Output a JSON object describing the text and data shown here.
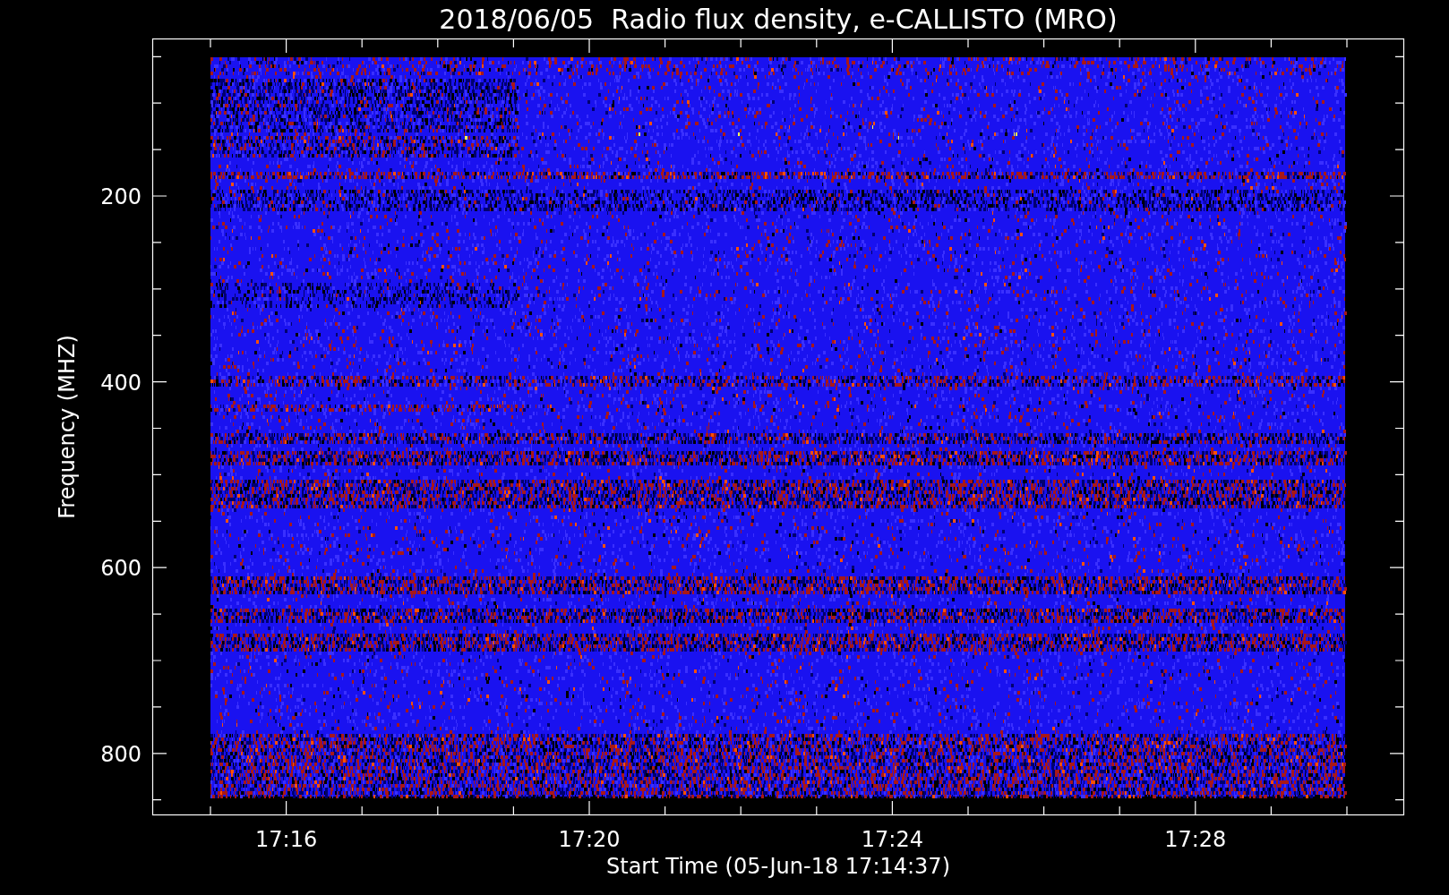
{
  "title": "2018/06/05  Radio flux density, e-CALLISTO (MRO)",
  "y_axis": {
    "label": "Frequency (MHZ)",
    "ticks": [
      "200",
      "400",
      "600",
      "800"
    ]
  },
  "x_axis": {
    "label": "Start Time (05-Jun-18 17:14:37)",
    "ticks": [
      "17:16",
      "17:20",
      "17:24",
      "17:28"
    ]
  }
}
